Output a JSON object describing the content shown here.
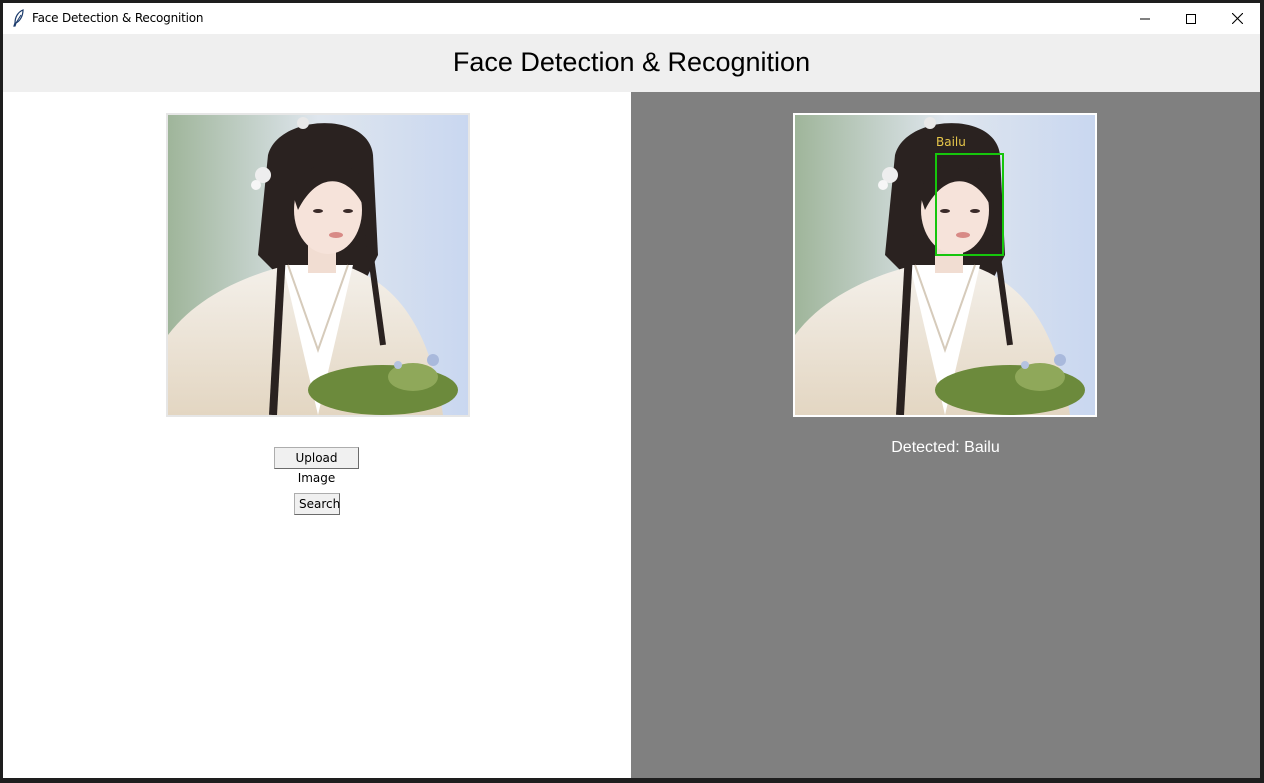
{
  "window": {
    "title": "Face Detection & Recognition"
  },
  "header": {
    "title": "Face Detection & Recognition"
  },
  "left_panel": {
    "image_icon": "portrait-photo",
    "upload_label": "Upload Image",
    "search_label": "Search"
  },
  "right_panel": {
    "image_icon": "portrait-photo-annotated",
    "face_label": "Bailu",
    "result_text": "Detected: Bailu",
    "box_color": "#16c60c",
    "label_color": "#e6c64a"
  },
  "colors": {
    "header_bg": "#efefef",
    "right_panel_bg": "#808080",
    "left_panel_bg": "#ffffff"
  }
}
